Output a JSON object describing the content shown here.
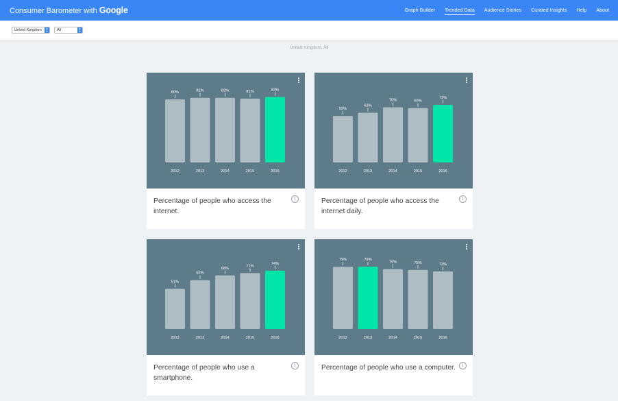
{
  "header": {
    "brand_prefix": "Consumer Barometer with",
    "brand_google": "Google",
    "nav": [
      "Graph Builder",
      "Trended Data",
      "Audience Stories",
      "Curated Insights",
      "Help",
      "About"
    ],
    "active_nav": "Trended Data"
  },
  "filters": {
    "country": "United Kingdom",
    "audience": "All"
  },
  "subtitle": "United Kingdom, All",
  "colors": {
    "accent": "#3b86f7",
    "plot_bg": "#5e7b8a",
    "bar": "#aebdc4",
    "highlight": "#00e6a8"
  },
  "cards": [
    {
      "caption": "Percentage of people who access the internet.",
      "menu_icon": "more-vert-icon",
      "info_icon": "info-icon"
    },
    {
      "caption": "Percentage of people who access the internet daily.",
      "menu_icon": "more-vert-icon",
      "info_icon": "info-icon"
    },
    {
      "caption": "Percentage of people who use a smartphone.",
      "menu_icon": "more-vert-icon",
      "info_icon": "info-icon"
    },
    {
      "caption": "Percentage of people who use a computer.",
      "menu_icon": "more-vert-icon",
      "info_icon": "info-icon"
    }
  ],
  "chart_data": [
    {
      "type": "bar",
      "categories": [
        "2012",
        "2013",
        "2014",
        "2015",
        "2016"
      ],
      "values": [
        80,
        82,
        82,
        81,
        83
      ],
      "labels": [
        "80%",
        "82%",
        "82%",
        "81%",
        "83%"
      ],
      "highlight": "2016",
      "ylim": [
        0,
        100
      ]
    },
    {
      "type": "bar",
      "categories": [
        "2012",
        "2013",
        "2014",
        "2015",
        "2016"
      ],
      "values": [
        59,
        63,
        70,
        69,
        73
      ],
      "labels": [
        "59%",
        "63%",
        "70%",
        "69%",
        "73%"
      ],
      "highlight": "2016",
      "ylim": [
        0,
        100
      ]
    },
    {
      "type": "bar",
      "categories": [
        "2012",
        "2013",
        "2014",
        "2015",
        "2016"
      ],
      "values": [
        51,
        62,
        68,
        71,
        74
      ],
      "labels": [
        "51%",
        "62%",
        "68%",
        "71%",
        "74%"
      ],
      "highlight": "2016",
      "ylim": [
        0,
        100
      ]
    },
    {
      "type": "bar",
      "categories": [
        "2012",
        "2013",
        "2014",
        "2015",
        "2016"
      ],
      "values": [
        79,
        79,
        76,
        75,
        73
      ],
      "labels": [
        "79%",
        "79%",
        "76%",
        "75%",
        "73%"
      ],
      "highlight": "2013",
      "ylim": [
        0,
        100
      ]
    }
  ]
}
